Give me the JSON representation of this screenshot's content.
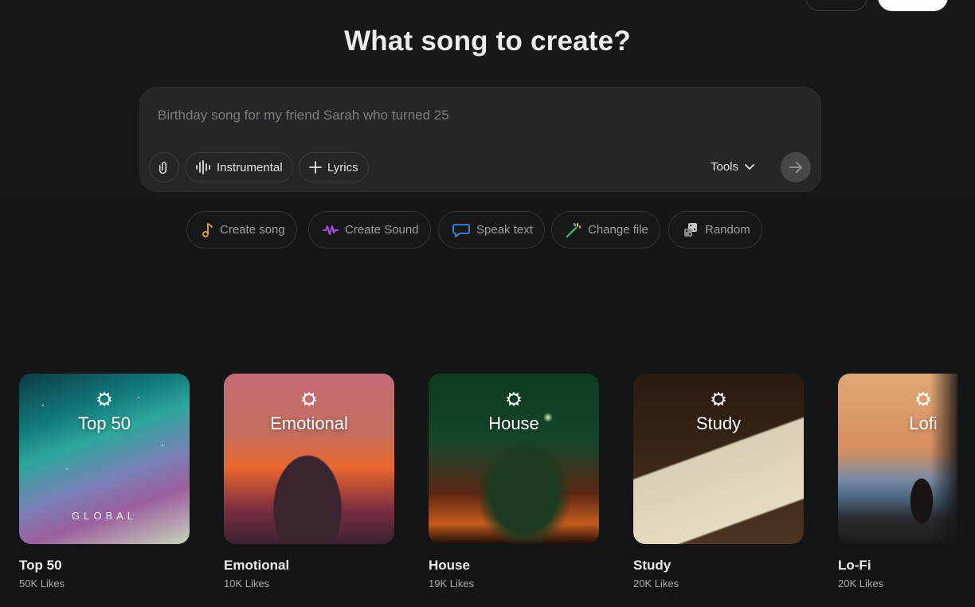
{
  "page": {
    "title": "What song to create?"
  },
  "prompt": {
    "placeholder": "Birthday song for my friend Sarah who turned 25",
    "instrumental_label": "Instrumental",
    "lyrics_label": "Lyrics",
    "tools_label": "Tools"
  },
  "quick_actions": [
    {
      "label": "Create song",
      "icon": "music-note-icon",
      "color": "#e8a23a"
    },
    {
      "label": "Create Sound",
      "icon": "waveform-icon",
      "color": "#b04ae0"
    },
    {
      "label": "Speak text",
      "icon": "speech-bubble-icon",
      "color": "#3a8be0"
    },
    {
      "label": "Change file",
      "icon": "magic-wand-icon",
      "color": "#3ac97a"
    },
    {
      "label": "Random",
      "icon": "dice-icon",
      "color": "#c8c8c8"
    }
  ],
  "cards": [
    {
      "overlay_title": "Top 50",
      "overlay_sub": "GLOBAL",
      "name": "Top 50",
      "likes": "50K Likes"
    },
    {
      "overlay_title": "Emotional",
      "name": "Emotional",
      "likes": "10K Likes"
    },
    {
      "overlay_title": "House",
      "name": "House",
      "likes": "19K Likes"
    },
    {
      "overlay_title": "Study",
      "name": "Study",
      "likes": "20K Likes"
    },
    {
      "overlay_title": "Lofi",
      "name": "Lo-Fi",
      "likes": "20K Likes"
    }
  ],
  "colors": {
    "background": "#141516",
    "prompt_box": "#242629",
    "accent_white": "#ffffff"
  }
}
